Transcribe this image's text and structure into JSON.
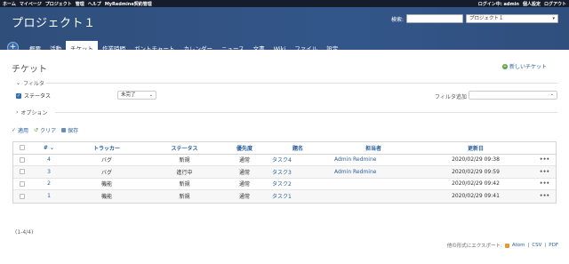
{
  "topbar": {
    "menu": [
      "ホーム",
      "マイページ",
      "プロジェクト",
      "管理",
      "ヘルプ",
      "MyRedmine契約管理"
    ],
    "account": [
      "ログイン中: admin",
      "個人設定",
      "ログアウト"
    ]
  },
  "header": {
    "project_title": "プロジェクト１",
    "search_label": "検索:",
    "search_value": "",
    "jump_select": "プロジェクト１"
  },
  "tabs": [
    "概要",
    "活動",
    "チケット",
    "作業時間",
    "ガントチャート",
    "カレンダー",
    "ニュース",
    "文書",
    "Wiki",
    "ファイル",
    "設定"
  ],
  "selected_tab": "チケット",
  "page": {
    "title": "チケット",
    "new_issue": "新しいチケット",
    "filters_legend": "フィルタ",
    "status_filter_label": "ステータス",
    "status_operator": "未完了",
    "add_filter_label": "フィルタ追加",
    "options_legend": "オプション",
    "apply": "適用",
    "clear": "クリア",
    "save": "保存"
  },
  "table": {
    "columns": [
      "#",
      "トラッカー",
      "ステータス",
      "優先度",
      "題名",
      "担当者",
      "更新日"
    ],
    "rows": [
      {
        "id": "4",
        "tracker": "バグ",
        "status": "新規",
        "priority": "通常",
        "subject": "タスク4",
        "assignee": "Admin Redmine",
        "updated": "2020/02/29 09:38"
      },
      {
        "id": "3",
        "tracker": "バグ",
        "status": "進行中",
        "priority": "通常",
        "subject": "タスク3",
        "assignee": "Admin Redmine",
        "updated": "2020/02/29 09:59"
      },
      {
        "id": "2",
        "tracker": "機能",
        "status": "新規",
        "priority": "通常",
        "subject": "タスク2",
        "assignee": "",
        "updated": "2020/02/29 09:42"
      },
      {
        "id": "1",
        "tracker": "機能",
        "status": "新規",
        "priority": "通常",
        "subject": "タスク1",
        "assignee": "",
        "updated": "2020/02/29 09:41"
      }
    ]
  },
  "footer": {
    "count": "(1-4/4)",
    "export_label": "他の形式にエクスポート:",
    "atom": "Atom",
    "csv": "CSV",
    "pdf": "PDF"
  },
  "colors": {
    "header": "#33568a",
    "topbar": "#151c2b",
    "link": "#2a5f9a",
    "tab_underline": "#c5a44a"
  }
}
